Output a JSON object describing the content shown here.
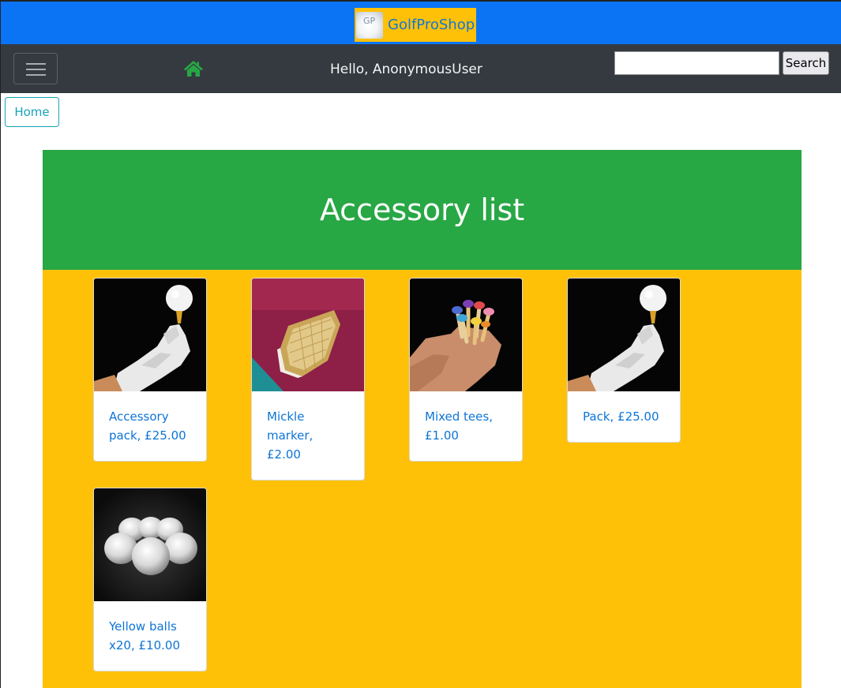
{
  "brand": {
    "logo_text": "GP",
    "name": "GolfProShop"
  },
  "navbar": {
    "greeting": "Hello, AnonymousUser",
    "search": {
      "value": "",
      "button_label": "Search"
    }
  },
  "breadcrumb": {
    "home_label": "Home"
  },
  "page": {
    "title": "Accessory list"
  },
  "products": [
    {
      "label": "Accessory pack, £25.00",
      "image": "gloved-hand-ball-on-tee"
    },
    {
      "label": "Mickle marker, £2.00",
      "image": "gold-ball-marker-on-pink"
    },
    {
      "label": "Mixed tees, £1.00",
      "image": "hand-holding-colored-tees"
    },
    {
      "label": "Pack, £25.00",
      "image": "gloved-hand-ball-on-tee"
    },
    {
      "label": "Yellow balls x20, £10.00",
      "image": "white-golf-balls"
    }
  ],
  "colors": {
    "brand_bar": "#0a74f5",
    "navbar": "#343a40",
    "jumbotron": "#28a745",
    "catalog": "#ffc107",
    "link": "#0d74d6",
    "home_icon": "#28a745"
  }
}
